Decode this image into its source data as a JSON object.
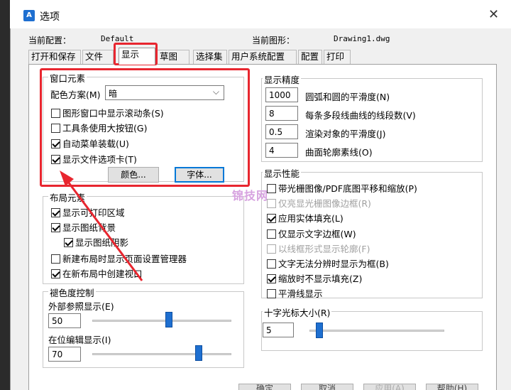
{
  "window": {
    "title": "选项",
    "close_glyph": "✕"
  },
  "config": {
    "current_profile_label": "当前配置：",
    "current_profile_value": "Default",
    "current_drawing_label": "当前图形：",
    "current_drawing_value": "Drawing1.dwg"
  },
  "tabs": [
    "打开和保存",
    "文件",
    "显示",
    "草图",
    "选择集",
    "用户系统配置",
    "配置",
    "打印"
  ],
  "window_elements": {
    "title": "窗口元素",
    "color_scheme_label": "配色方案(M)",
    "color_scheme_value": "暗",
    "checkboxes": [
      {
        "label": "图形窗口中显示滚动条(S)",
        "checked": false
      },
      {
        "label": "工具条使用大按钮(G)",
        "checked": false
      },
      {
        "label": "自动菜单装载(U)",
        "checked": true
      },
      {
        "label": "显示文件选项卡(T)",
        "checked": true
      }
    ],
    "colors_button": "颜色...",
    "fonts_button": "字体..."
  },
  "layout_elements": {
    "title": "布局元素",
    "checkboxes": [
      {
        "label": "显示可打印区域",
        "checked": true
      },
      {
        "label": "显示图纸背景",
        "checked": true
      },
      {
        "label": "显示图纸阴影",
        "checked": true
      },
      {
        "label": "新建布局时显示页面设置管理器",
        "checked": false
      },
      {
        "label": "在新布局中创建视口",
        "checked": true
      }
    ]
  },
  "fade_control": {
    "title": "褪色度控制",
    "xref_label": "外部参照显示(E)",
    "xref_value": "50",
    "xref_level": 50,
    "inplace_label": "在位编辑显示(I)",
    "inplace_value": "70",
    "inplace_level": 70
  },
  "display_resolution": {
    "title": "显示精度",
    "rows": [
      {
        "value": "1000",
        "label": "圆弧和圆的平滑度(N)"
      },
      {
        "value": "8",
        "label": "每条多段线曲线的线段数(V)"
      },
      {
        "value": "0.5",
        "label": "渲染对象的平滑度(J)"
      },
      {
        "value": "4",
        "label": "曲面轮廓素线(O)"
      }
    ]
  },
  "display_performance": {
    "title": "显示性能",
    "checkboxes": [
      {
        "label": "带光栅图像/PDF底图平移和缩放(P)",
        "checked": false,
        "disabled": false
      },
      {
        "label": "仅亮显光栅图像边框(R)",
        "checked": false,
        "disabled": true
      },
      {
        "label": "应用实体填充(L)",
        "checked": true,
        "disabled": false
      },
      {
        "label": "仅显示文字边框(W)",
        "checked": false,
        "disabled": false
      },
      {
        "label": "以线框形式显示轮廓(F)",
        "checked": false,
        "disabled": true
      },
      {
        "label": "文字无法分辨时显示为框(B)",
        "checked": false,
        "disabled": false
      },
      {
        "label": "缩放时不显示填充(Z)",
        "checked": true,
        "disabled": false
      },
      {
        "label": "平滑线显示",
        "checked": false,
        "disabled": false
      }
    ]
  },
  "crosshair": {
    "title": "十字光标大小(R)",
    "value": "5",
    "level": 5
  },
  "watermark": "锦技网",
  "footer_buttons": [
    "确定",
    "取消",
    "应用(A)",
    "帮助(H)"
  ],
  "colors": {
    "highlight": "#e8262f",
    "slider_thumb": "#1e6fd0"
  }
}
